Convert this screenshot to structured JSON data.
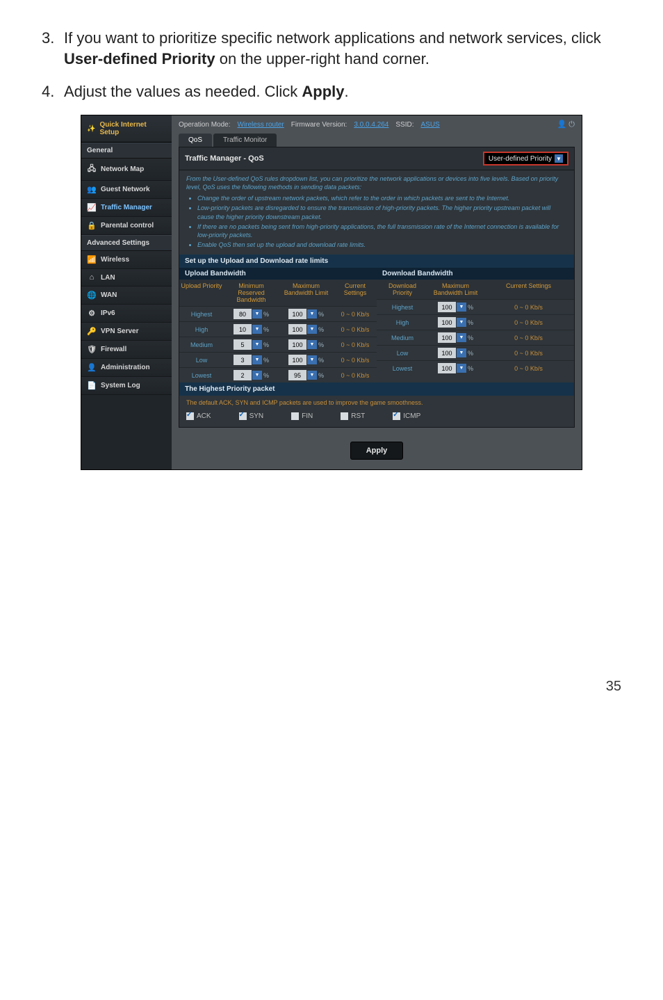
{
  "instructions": {
    "step3_num": "3.",
    "step3_pre": "If you want to prioritize specific network applications and network services, click ",
    "step3_bold": "User-defined Priority",
    "step3_post": " on the upper-right hand corner.",
    "step4_num": "4.",
    "step4_pre": "Adjust the values as needed. Click ",
    "step4_bold": "Apply",
    "step4_post": "."
  },
  "topbar": {
    "op_mode_label": "Operation Mode:",
    "op_mode_value": "Wireless router",
    "fw_label": "Firmware Version:",
    "fw_value": "3.0.0.4.264",
    "ssid_label": "SSID:",
    "ssid_value": "ASUS"
  },
  "sidebar": {
    "quick": "Quick Internet Setup",
    "general": "General",
    "items": [
      {
        "label": "Network Map",
        "icon": "🖧",
        "cls": ""
      },
      {
        "label": "Guest Network",
        "icon": "👥",
        "cls": ""
      },
      {
        "label": "Traffic Manager",
        "icon": "📈",
        "cls": "tm"
      },
      {
        "label": "Parental control",
        "icon": "🔒",
        "cls": ""
      }
    ],
    "advanced": "Advanced Settings",
    "adv_items": [
      {
        "label": "Wireless",
        "icon": "📶"
      },
      {
        "label": "LAN",
        "icon": "⌂"
      },
      {
        "label": "WAN",
        "icon": "🌐"
      },
      {
        "label": "IPv6",
        "icon": "⚙"
      },
      {
        "label": "VPN Server",
        "icon": "🔑"
      },
      {
        "label": "Firewall",
        "icon": "🛡"
      },
      {
        "label": "Administration",
        "icon": "👤"
      },
      {
        "label": "System Log",
        "icon": "📄"
      }
    ]
  },
  "tabs": {
    "qos": "QoS",
    "tm": "Traffic Monitor"
  },
  "panel": {
    "title": "Traffic Manager - QoS",
    "udp_btn": "User-defined Priority",
    "desc_intro": "From the User-defined QoS rules dropdown list, you can prioritize the network applications or devices into five levels. Based on priority level, QoS uses the following methods in sending data packets:",
    "bullets": [
      "Change the order of upstream network packets, which refer to the order in which packets are sent to the Internet.",
      "Low-priority packets are disregarded to ensure the transmission of high-priority packets. The higher priority upstream packet will cause the higher priority downstream packet.",
      "If there are no packets being sent from high-priority applications, the full transmission rate of the Internet connection is available for low-priority packets.",
      "Enable QoS then set up the upload and download rate limits."
    ],
    "setup_bar": "Set up the Upload and Download rate limits",
    "upload_head": "Upload Bandwidth",
    "download_head": "Download Bandwidth",
    "col_upload_priority": "Upload Priority",
    "col_min": "Minimum Reserved Bandwidth",
    "col_max": "Maximum Bandwidth Limit",
    "col_cur": "Current Settings",
    "col_download_priority": "Download Priority",
    "col_dmax": "Maximum Bandwidth Limit",
    "col_dcur": "Current Settings",
    "rows": [
      {
        "p": "Highest",
        "umin": "80",
        "umax": "100",
        "ucur": "0 ~ 0 Kb/s",
        "dp": "Highest",
        "dmax": "100",
        "dcur": "0 ~ 0 Kb/s"
      },
      {
        "p": "High",
        "umin": "10",
        "umax": "100",
        "ucur": "0 ~ 0 Kb/s",
        "dp": "High",
        "dmax": "100",
        "dcur": "0 ~ 0 Kb/s"
      },
      {
        "p": "Medium",
        "umin": "5",
        "umax": "100",
        "ucur": "0 ~ 0 Kb/s",
        "dp": "Medium",
        "dmax": "100",
        "dcur": "0 ~ 0 Kb/s"
      },
      {
        "p": "Low",
        "umin": "3",
        "umax": "100",
        "ucur": "0 ~ 0 Kb/s",
        "dp": "Low",
        "dmax": "100",
        "dcur": "0 ~ 0 Kb/s"
      },
      {
        "p": "Lowest",
        "umin": "2",
        "umax": "95",
        "ucur": "0 ~ 0 Kb/s",
        "dp": "Lowest",
        "dmax": "100",
        "dcur": "0 ~ 0 Kb/s"
      }
    ],
    "hp_bar": "The Highest Priority packet",
    "hp_desc": "The default ACK, SYN and ICMP packets are used to improve the game smoothness.",
    "hp_opts": [
      {
        "label": "ACK",
        "on": true
      },
      {
        "label": "SYN",
        "on": true
      },
      {
        "label": "FIN",
        "on": false
      },
      {
        "label": "RST",
        "on": false
      },
      {
        "label": "ICMP",
        "on": true
      }
    ],
    "apply": "Apply"
  },
  "page_number": "35"
}
